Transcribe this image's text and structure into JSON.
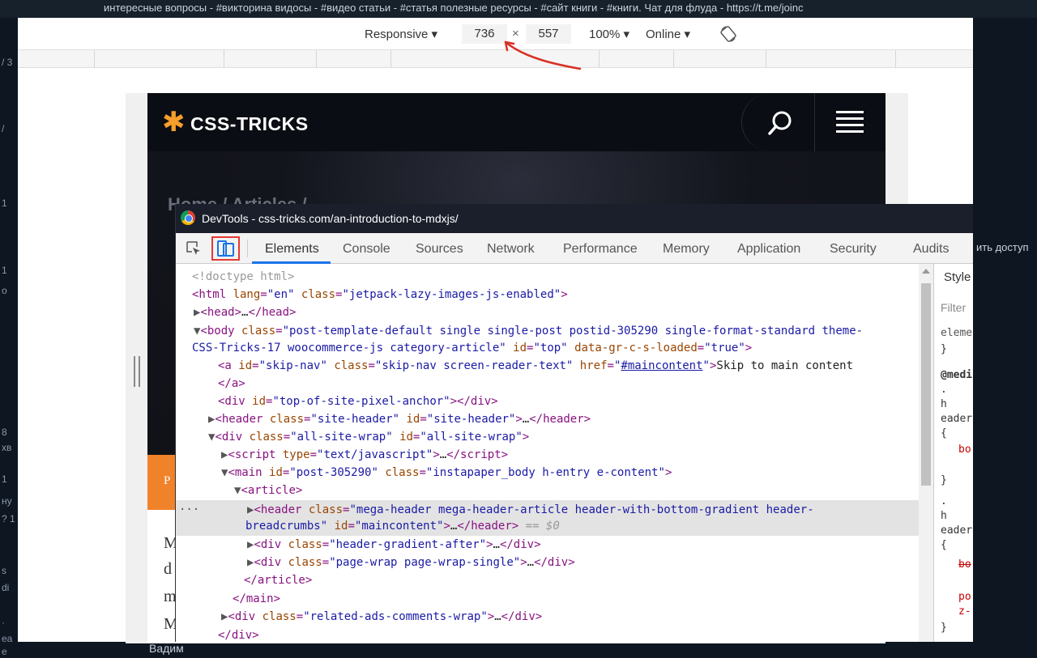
{
  "background": {
    "ticker": "интересные вопросы - #викторина видосы - #видео статьи - #статья полезные ресурсы - #сайт книги - #книги. Чат для флуда - https://t.me/joinc",
    "right_snippet": "ить доступ",
    "left_fragments": [
      "/ 3",
      "/",
      "1",
      "1",
      "о",
      "8",
      "хв",
      "1",
      "ну",
      "? 1",
      "s",
      "di",
      "·",
      "ea",
      "e"
    ],
    "bottom_name": "Вадим"
  },
  "device_toolbar": {
    "device": "Responsive",
    "width": "736",
    "times": "×",
    "height": "557",
    "zoom": "100%",
    "network": "Online",
    "rotate_icon": "rotate-icon"
  },
  "site": {
    "logo_star": "✱",
    "logo_text": "CSS-TRICKS",
    "breadcrumb": "Home / Articles /",
    "band_letter": "P",
    "body_letters": [
      "M",
      "d",
      "m",
      "M"
    ]
  },
  "devtools": {
    "title": "DevTools - css-tricks.com/an-introduction-to-mdxjs/",
    "tabs": [
      "Elements",
      "Console",
      "Sources",
      "Network",
      "Performance",
      "Memory",
      "Application",
      "Security",
      "Audits"
    ],
    "active_tab": "Elements",
    "styles": [
      "Style",
      "Filter",
      "eleme",
      "}",
      "@medi",
      ".",
      "h",
      "eader",
      "{",
      "bo",
      "}",
      ".",
      "h",
      "eader",
      "{",
      "bo",
      "po",
      "z-",
      "}"
    ]
  },
  "accent": {
    "orange": "#f0822a",
    "devtools_blue": "#1a73e8",
    "highlight_red": "#e53935",
    "annotation": "#d93025"
  }
}
